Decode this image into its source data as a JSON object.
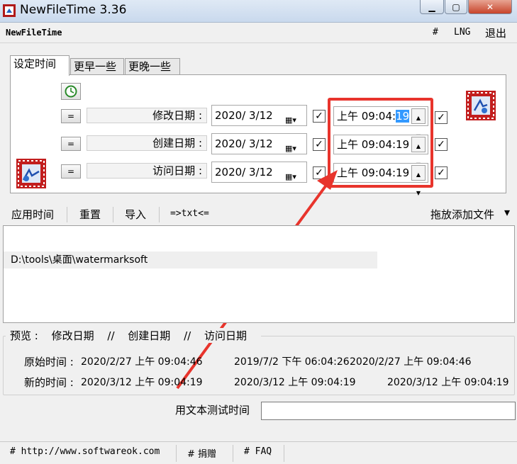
{
  "window": {
    "title": "NewFileTime 3.36"
  },
  "menubar": {
    "app_label": "NewFileTime",
    "hash": "#",
    "lng": "LNG",
    "exit": "退出"
  },
  "tabs": [
    {
      "label": "设定时间",
      "active": true
    },
    {
      "label": "更早一些",
      "active": false
    },
    {
      "label": "更晚一些",
      "active": false
    }
  ],
  "rows": [
    {
      "eq": "=",
      "label": "修改日期 :",
      "date": "2020/ 3/12",
      "time_prefix": "上午 09:04:",
      "time_sel": "19",
      "time_full": ""
    },
    {
      "eq": "=",
      "label": "创建日期 :",
      "date": "2020/ 3/12",
      "time_prefix": "上午 09:04:19",
      "time_sel": "",
      "time_full": ""
    },
    {
      "eq": "=",
      "label": "访问日期 :",
      "date": "2020/ 3/12",
      "time_prefix": "上午 09:04:19",
      "time_sel": "",
      "time_full": ""
    }
  ],
  "toolbar": {
    "apply": "应用时间",
    "reset": "重置",
    "import": "导入",
    "txt": "=>txt<=",
    "dropadd": "拖放添加文件",
    "dropdown_arrow": "▾"
  },
  "files": [
    "D:\\tools\\桌面\\watermarksoft"
  ],
  "preview": {
    "legend_preview": "预览 :",
    "legend_modified": "修改日期",
    "legend_sep1": "//",
    "legend_created": "创建日期",
    "legend_sep2": "//",
    "legend_accessed": "访问日期",
    "orig_label": "原始时间 :",
    "orig_modified": "2020/2/27 上午 09:04:46",
    "orig_created": "2019/7/2 下午 06:04:26",
    "orig_accessed": "2020/2/27 上午 09:04:46",
    "new_label": "新的时间 :",
    "new_modified": "2020/3/12 上午 09:04:19",
    "new_created": "2020/3/12 上午 09:04:19",
    "new_accessed": "2020/3/12 上午 09:04:19"
  },
  "test": {
    "label": "用文本测试时间",
    "value": ""
  },
  "status": {
    "site": "# http://www.softwareok.com",
    "donate": "# 捐赠",
    "faq": "# FAQ"
  },
  "colors": {
    "highlight_box": "#e8342c",
    "selection": "#3399ff"
  }
}
